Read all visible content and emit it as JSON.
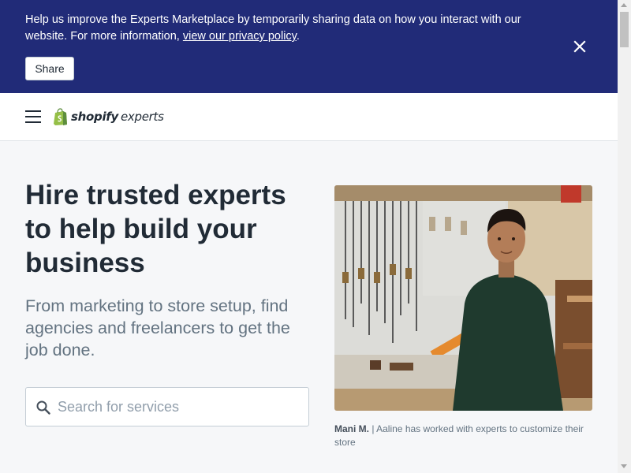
{
  "banner": {
    "text": "Help us improve the Experts Marketplace by temporarily sharing data on how you interact with our website. For more information, ",
    "link_text": "view our privacy policy",
    "suffix": ".",
    "share_label": "Share",
    "close_icon": "close-icon",
    "background": "#212b78"
  },
  "header": {
    "menu_icon": "hamburger-icon",
    "logo_word": "shopify",
    "logo_sub": "experts",
    "logo_color": "#95bf47"
  },
  "hero": {
    "title": "Hire trusted experts to help build your business",
    "subtitle": "From marketing to store setup, find agencies and freelancers to get the job done.",
    "search_placeholder": "Search for services",
    "search_value": ""
  },
  "photo": {
    "caption_name": "Mani M.",
    "caption_text": " | Aaline has worked with experts to customize their store"
  }
}
